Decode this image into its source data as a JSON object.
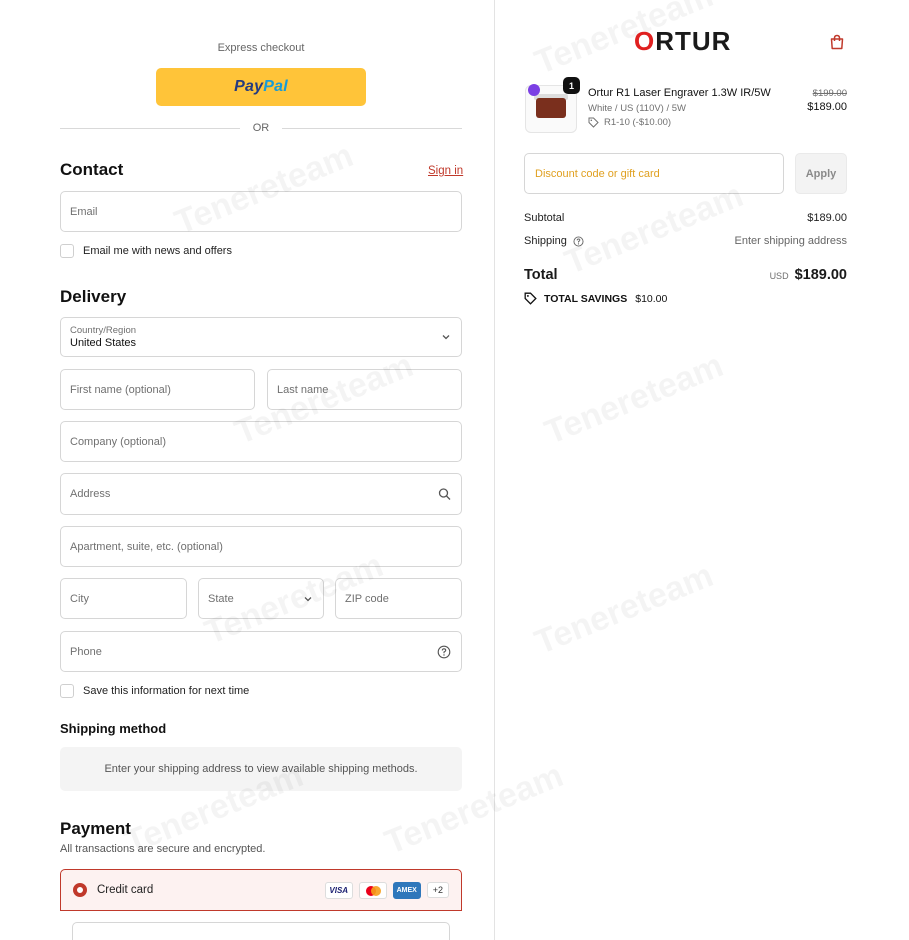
{
  "express": {
    "label": "Express checkout",
    "paypal_1": "Pay",
    "paypal_2": "Pal",
    "or": "OR"
  },
  "contact": {
    "title": "Contact",
    "signin": "Sign in",
    "email_placeholder": "Email",
    "news_label": "Email me with news and offers"
  },
  "delivery": {
    "title": "Delivery",
    "country_label": "Country/Region",
    "country_value": "United States",
    "first_name": "First name (optional)",
    "last_name": "Last name",
    "company": "Company (optional)",
    "address": "Address",
    "apartment": "Apartment, suite, etc. (optional)",
    "city": "City",
    "state": "State",
    "zip": "ZIP code",
    "phone": "Phone",
    "save_info": "Save this information for next time"
  },
  "shipping_method": {
    "title": "Shipping method",
    "message": "Enter your shipping address to view available shipping methods."
  },
  "payment": {
    "title": "Payment",
    "subtitle": "All transactions are secure and encrypted.",
    "credit_card": "Credit card",
    "card_visa": "VISA",
    "card_amex": "AMEX",
    "more_cards": "+2"
  },
  "store": {
    "logo_o": "O",
    "logo_rest": "RTUR"
  },
  "cart": {
    "quantity": "1",
    "product_name": "Ortur R1 Laser Engraver 1.3W IR/5W",
    "variant": "White / US (110V) / 5W",
    "discount": "R1-10 (-$10.00)",
    "old_price": "$199.00",
    "price": "$189.00",
    "discount_placeholder": "Discount code or gift card",
    "apply": "Apply",
    "subtotal_label": "Subtotal",
    "subtotal_value": "$189.00",
    "shipping_label": "Shipping",
    "shipping_value": "Enter shipping address",
    "total_label": "Total",
    "total_currency": "USD",
    "total_value": "$189.00",
    "savings_label": "TOTAL SAVINGS",
    "savings_value": "$10.00"
  },
  "watermark": "Tenereteam"
}
